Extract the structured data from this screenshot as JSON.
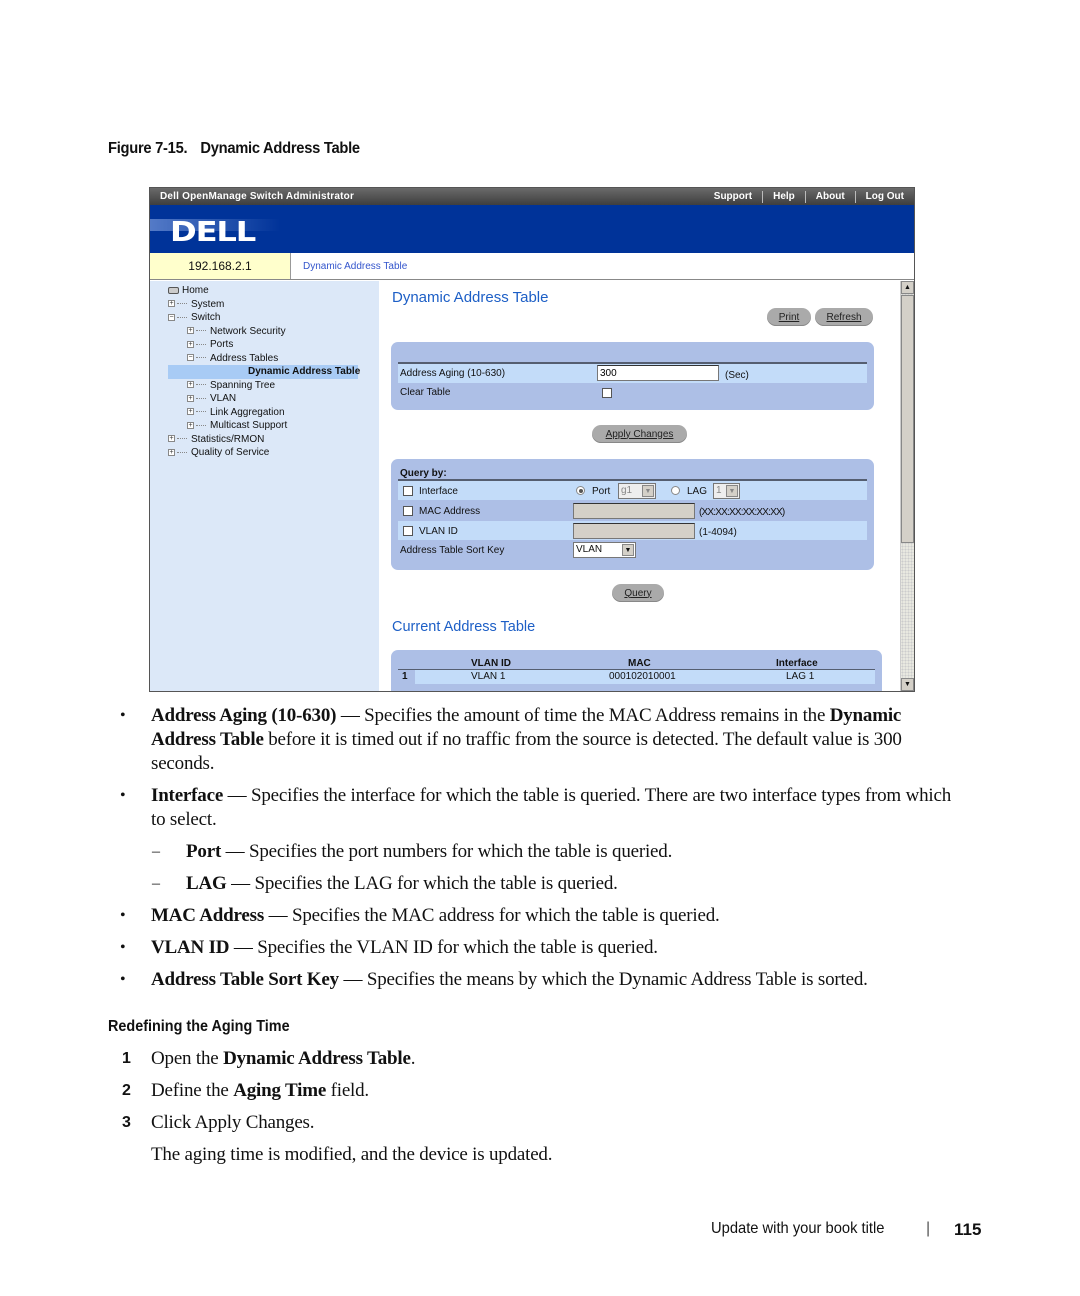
{
  "figure": {
    "number": "Figure 7-15.",
    "title": "Dynamic Address Table"
  },
  "app": {
    "title": "Dell OpenManage Switch Administrator",
    "top_links": [
      "Support",
      "Help",
      "About",
      "Log Out"
    ],
    "logo": "DELL",
    "ip": "192.168.2.1",
    "breadcrumb": "Dynamic Address Table"
  },
  "nav": {
    "items": [
      {
        "label": "Home",
        "level": 0,
        "icon": "home-icon"
      },
      {
        "label": "System",
        "level": 1,
        "expander": "+"
      },
      {
        "label": "Switch",
        "level": 1,
        "expander": "-"
      },
      {
        "label": "Network Security",
        "level": 2,
        "expander": "+"
      },
      {
        "label": "Ports",
        "level": 2,
        "expander": "+"
      },
      {
        "label": "Address Tables",
        "level": 2,
        "expander": "-"
      },
      {
        "label": "Dynamic Address Table",
        "level": 3,
        "selected": true
      },
      {
        "label": "Spanning Tree",
        "level": 2,
        "expander": "+"
      },
      {
        "label": "VLAN",
        "level": 2,
        "expander": "+"
      },
      {
        "label": "Link Aggregation",
        "level": 2,
        "expander": "+"
      },
      {
        "label": "Multicast Support",
        "level": 2,
        "expander": "+"
      },
      {
        "label": "Statistics/RMON",
        "level": 1,
        "expander": "+"
      },
      {
        "label": "Quality of Service",
        "level": 1,
        "expander": "+"
      }
    ]
  },
  "content": {
    "title": "Dynamic Address Table",
    "print_label": "Print",
    "refresh_label": "Refresh",
    "aging_label": "Address Aging (10-630)",
    "aging_value": "300",
    "aging_unit": "(Sec)",
    "clear_label": "Clear Table",
    "clear_checked": false,
    "apply_label": "Apply Changes",
    "query": {
      "heading": "Query by:",
      "interface_label": "Interface",
      "port_label": "Port",
      "port_value": "g1",
      "port_selected": true,
      "lag_label": "LAG",
      "lag_value": "1",
      "mac_label": "MAC Address",
      "mac_value": "",
      "mac_hint": "(XX:XX:XX:XX:XX:XX)",
      "vlan_label": "VLAN ID",
      "vlan_value": "",
      "vlan_hint": "(1-4094)",
      "sort_label": "Address Table Sort Key",
      "sort_value": "VLAN",
      "query_label": "Query"
    },
    "current_title": "Current Address Table",
    "table": {
      "columns": [
        "",
        "VLAN ID",
        "MAC",
        "Interface"
      ],
      "rows": [
        [
          "1",
          "VLAN 1",
          "000102010001",
          "LAG 1"
        ]
      ]
    }
  },
  "doc": {
    "bullets": [
      {
        "term": "Address Aging (10-630)",
        "text": " — Specifies the amount of time the MAC Address remains in the ",
        "term2": "Dynamic Address Table",
        "text2": " before it is timed out if no traffic from the source is detected. The default value is 300 seconds."
      },
      {
        "term": "Interface",
        "text": " — Specifies the interface for which the table is queried. There are two interface types from which to select."
      },
      {
        "term": "Port",
        "text": " — Specifies the port numbers for which the table is queried.",
        "sub": true
      },
      {
        "term": "LAG",
        "text": " — Specifies the LAG for which the table is queried.",
        "sub": true
      },
      {
        "term": "MAC Address",
        "text": " — Specifies the MAC address for which the table is queried."
      },
      {
        "term": "VLAN ID",
        "text": " — Specifies the VLAN ID for which the table is queried."
      },
      {
        "term": "Address Table Sort Key",
        "text": " — Specifies the means by which the Dynamic Address Table is sorted."
      }
    ],
    "section_heading": "Redefining the Aging Time",
    "steps": [
      {
        "num": "1",
        "pre": "Open the ",
        "bold": "Dynamic Address Table",
        "post": "."
      },
      {
        "num": "2",
        "pre": "Define the ",
        "bold": "Aging Time",
        "post": " field."
      },
      {
        "num": "3",
        "pre": "Click Apply Changes.",
        "bold": "",
        "post": ""
      }
    ],
    "result": "The aging time is modified, and the device is updated."
  },
  "footer": {
    "book_title": "Update with your book title",
    "separator": "|",
    "page": "115"
  }
}
